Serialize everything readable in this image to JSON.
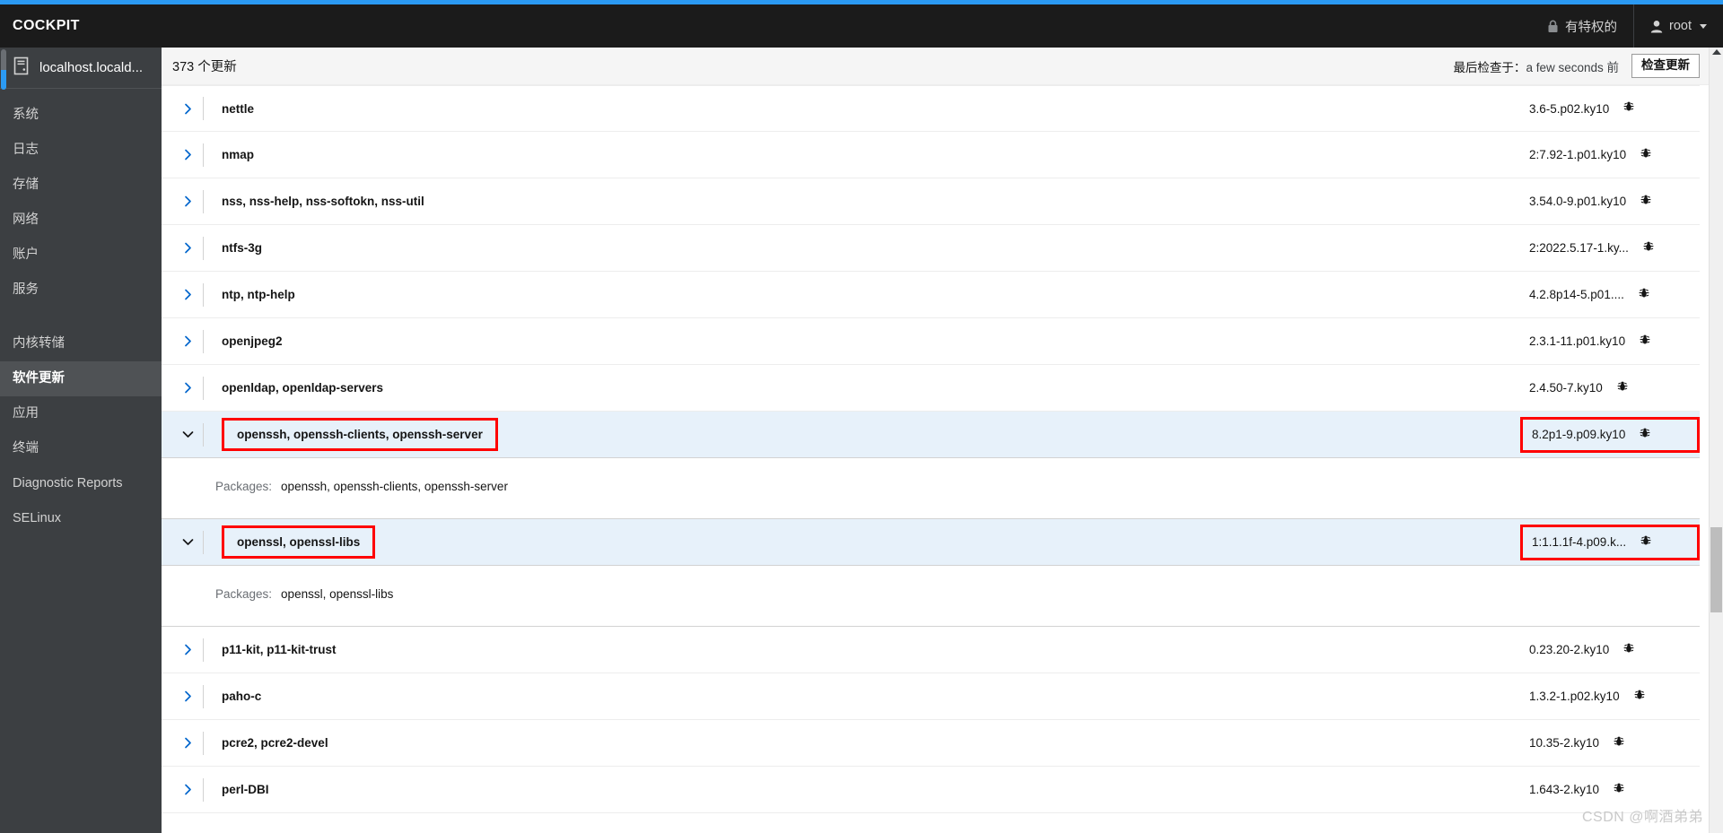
{
  "theme": {
    "accent": "#2b9af3",
    "masthead_bg": "#1b1b1b",
    "sidebar_bg": "#3c3f42",
    "sidebar_active_bg": "#4f5255",
    "row_expanded_bg": "#e7f1fa",
    "highlight_box": "#ff0000",
    "link": "#0066cc"
  },
  "masthead": {
    "brand": "COCKPIT",
    "privileged_label": "有特权的",
    "privileged_icon": "lock-icon",
    "user_label": "root",
    "user_icon": "user-icon",
    "caret_icon": "chevron-down-icon"
  },
  "sidebar": {
    "host": {
      "icon": "server-icon",
      "name": "localhost.locald..."
    },
    "items": [
      {
        "label": "系统",
        "active": false,
        "gap": false
      },
      {
        "label": "日志",
        "active": false,
        "gap": false
      },
      {
        "label": "存储",
        "active": false,
        "gap": false
      },
      {
        "label": "网络",
        "active": false,
        "gap": false
      },
      {
        "label": "账户",
        "active": false,
        "gap": false
      },
      {
        "label": "服务",
        "active": false,
        "gap": false
      },
      {
        "label": "内核转储",
        "active": false,
        "gap": true
      },
      {
        "label": "软件更新",
        "active": true,
        "gap": false
      },
      {
        "label": "应用",
        "active": false,
        "gap": false
      },
      {
        "label": "终端",
        "active": false,
        "gap": false
      },
      {
        "label": "Diagnostic Reports",
        "active": false,
        "gap": false
      },
      {
        "label": "SELinux",
        "active": false,
        "gap": false
      }
    ]
  },
  "toolbar": {
    "updates_count": "373 个更新",
    "last_checked_label": "最后检查于：",
    "last_checked_value": "a few seconds 前",
    "check_updates_button": "检查更新"
  },
  "table": {
    "packages_label": "Packages:",
    "bug_icon": "bug-icon",
    "collapsed_icon": "chevron-right-icon",
    "expanded_icon": "chevron-down-icon",
    "rows": [
      {
        "name": "nettle",
        "version": "3.6-5.p02.ky10",
        "expanded": false,
        "highlighted": false
      },
      {
        "name": "nmap",
        "version": "2:7.92-1.p01.ky10",
        "expanded": false,
        "highlighted": false
      },
      {
        "name": "nss, nss-help, nss-softokn, nss-util",
        "version": "3.54.0-9.p01.ky10",
        "expanded": false,
        "highlighted": false
      },
      {
        "name": "ntfs-3g",
        "version": "2:2022.5.17-1.ky...",
        "expanded": false,
        "highlighted": false
      },
      {
        "name": "ntp, ntp-help",
        "version": "4.2.8p14-5.p01....",
        "expanded": false,
        "highlighted": false
      },
      {
        "name": "openjpeg2",
        "version": "2.3.1-11.p01.ky10",
        "expanded": false,
        "highlighted": false
      },
      {
        "name": "openldap, openldap-servers",
        "version": "2.4.50-7.ky10",
        "expanded": false,
        "highlighted": false
      },
      {
        "name": "openssh, openssh-clients, openssh-server",
        "version": "8.2p1-9.p09.ky10",
        "expanded": true,
        "highlighted": true,
        "packages": "openssh, openssh-clients, openssh-server"
      },
      {
        "name": "openssl, openssl-libs",
        "version": "1:1.1.1f-4.p09.k...",
        "expanded": true,
        "highlighted": true,
        "packages": "openssl, openssl-libs"
      },
      {
        "name": "p11-kit, p11-kit-trust",
        "version": "0.23.20-2.ky10",
        "expanded": false,
        "highlighted": false
      },
      {
        "name": "paho-c",
        "version": "1.3.2-1.p02.ky10",
        "expanded": false,
        "highlighted": false
      },
      {
        "name": "pcre2, pcre2-devel",
        "version": "10.35-2.ky10",
        "expanded": false,
        "highlighted": false
      },
      {
        "name": "perl-DBI",
        "version": "1.643-2.ky10",
        "expanded": false,
        "highlighted": false
      }
    ]
  },
  "watermark": {
    "text": "CSDN @啊酒弟弟"
  }
}
